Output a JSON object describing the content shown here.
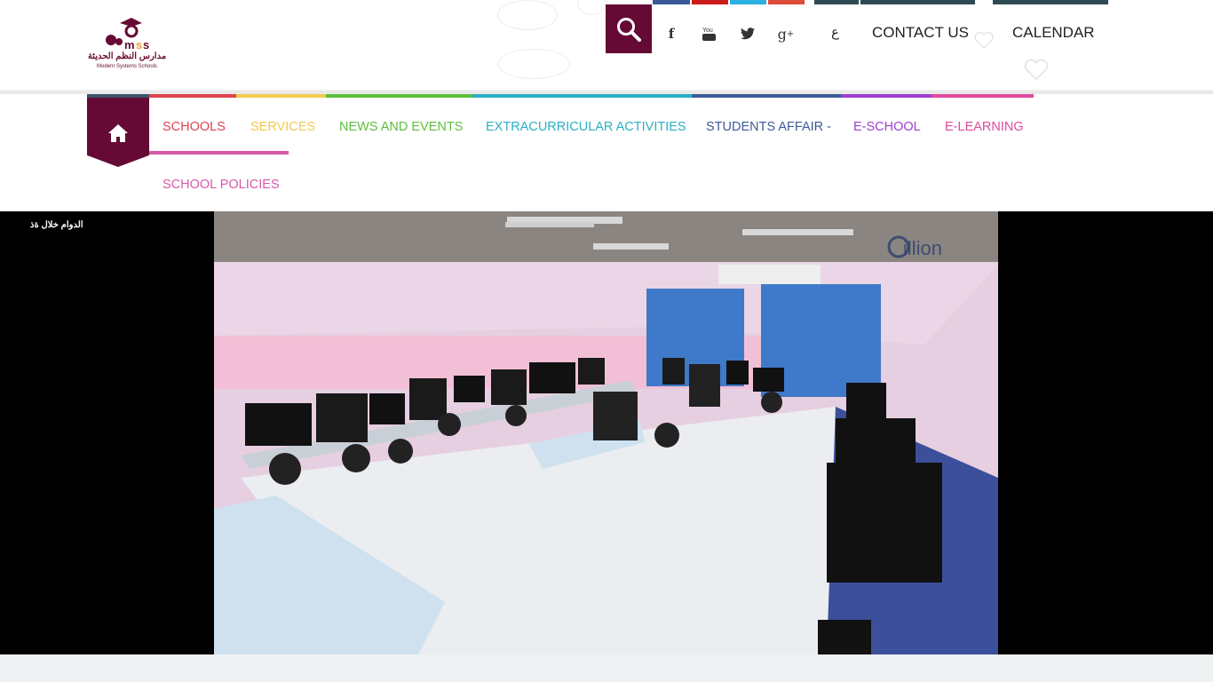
{
  "brand": {
    "logo_text": "MSS",
    "name_ar": "مدارس النظم الحديثة",
    "name_en": "Modern Systems Schools"
  },
  "header": {
    "lang_label": "ع",
    "contact_label": "CONTACT US",
    "calendar_label": "CALENDAR",
    "social": [
      {
        "icon": "facebook-icon",
        "glyph": "f"
      },
      {
        "icon": "youtube-icon",
        "glyph": "You"
      },
      {
        "icon": "twitter-icon",
        "glyph": "🐦"
      },
      {
        "icon": "google-plus-icon",
        "glyph": "g+"
      }
    ]
  },
  "nav": {
    "items": [
      {
        "label": "SCHOOLS",
        "color": "#e0444f"
      },
      {
        "label": "SERVICES",
        "color": "#f2c94c"
      },
      {
        "label": "NEWS AND EVENTS",
        "color": "#5cbf3b"
      },
      {
        "label": "EXTRACURRICULAR ACTIVITIES",
        "color": "#2ab0c4"
      },
      {
        "label": "STUDENTS AFFAIR -",
        "color": "#3c5a99"
      },
      {
        "label": "E-SCHOOL",
        "color": "#9b3fd0"
      },
      {
        "label": "E-LEARNING",
        "color": "#e0499e"
      },
      {
        "label": "SCHOOL POLICIES",
        "color": "#d65aa8"
      }
    ],
    "home_icon": "home-icon"
  },
  "video": {
    "caption": "الدوام خلال ةذ",
    "watermark": "illion"
  },
  "colors": {
    "accent": "#650a35",
    "topbar": [
      "#3b5998",
      "#cc1b1b",
      "#2ab0e0",
      "#dd4b39",
      "#2d4a52"
    ]
  }
}
